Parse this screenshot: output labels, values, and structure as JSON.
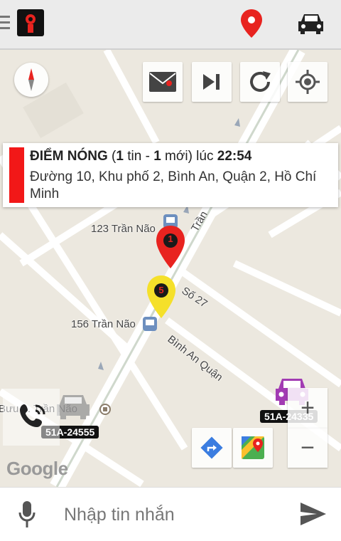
{
  "topbar": {
    "menu_icon": "menu-icon",
    "logo_icon": "app-logo",
    "pin_icon": "map-pin-icon",
    "car_icon": "car-icon",
    "pin_color": "#e8231f"
  },
  "map_controls": {
    "compass": "compass-icon",
    "mail": "mail-icon",
    "skip": "skip-next-icon",
    "refresh": "refresh-icon",
    "locate": "my-location-icon"
  },
  "info_card": {
    "title": "ĐIỂM NÓNG",
    "open_paren": " (",
    "tin_count": "1",
    "tin_text": " tin - ",
    "moi_count": "1",
    "moi_text": " mới) lúc ",
    "time": "22:54",
    "address": "Đường 10, Khu phố 2, Bình An, Quận 2, Hồ Chí Minh",
    "accent": "#f21818"
  },
  "map_labels": {
    "l123": "123 Trần Não",
    "l156": "156 Trần Não",
    "so27": "Số 27",
    "binh_an": "Bình An Quận",
    "tran": "Trần",
    "buu": "Bưu ... Trần Não"
  },
  "markers": {
    "red_num": "1",
    "yellow_num": "5",
    "plate_left": "51A-24555",
    "plate_right": "51A-24335"
  },
  "map_buttons": {
    "zoom_in": "+",
    "zoom_out": "−",
    "directions": "directions-icon",
    "maps": "google-maps-icon",
    "call": "phone-icon"
  },
  "google_logo": "Google",
  "bottom": {
    "placeholder": "Nhập tin nhắn",
    "mic": "microphone-icon",
    "send": "send-icon"
  }
}
